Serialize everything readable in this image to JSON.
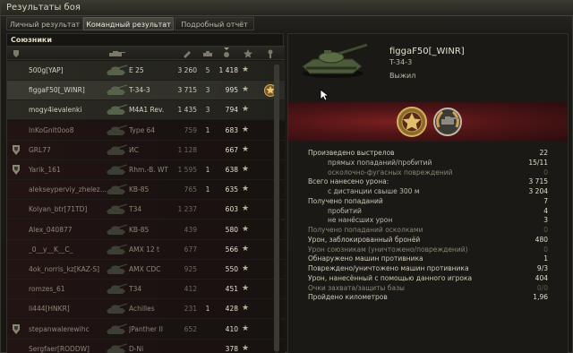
{
  "window": {
    "title": "Результаты боя"
  },
  "tabs": [
    "Личный результат",
    "Командный результат",
    "Подробный отчёт"
  ],
  "active_tab": 1,
  "left": {
    "section_title": "Союзники",
    "players": [
      {
        "player": "500g[YAP]",
        "tank": "E 25",
        "damage": "3 260",
        "kills": "5",
        "xp": "1 418",
        "state": "alive",
        "icon": "none"
      },
      {
        "player": "figgaF50[_WINR]",
        "tank": "T-34-3",
        "damage": "3 715",
        "kills": "3",
        "xp": "995",
        "state": "selected",
        "icon": "none",
        "badge": "medal-icon"
      },
      {
        "player": "mogy4ievalenki",
        "tank": "M4A1 Rev.",
        "damage": "1 435",
        "kills": "3",
        "xp": "794",
        "state": "alive",
        "icon": "none"
      },
      {
        "player": "InKoGnIt0oo8",
        "tank": "Type 64",
        "damage": "759",
        "kills": "1",
        "xp": "683",
        "state": "dead",
        "icon": "none"
      },
      {
        "player": "GRL77",
        "tank": "ИС",
        "damage": "1 128",
        "kills": "",
        "xp": "667",
        "state": "dead",
        "icon": "platoon"
      },
      {
        "player": "Yarik_161",
        "tank": "Rhm.-B. WT",
        "damage": "1 595",
        "kills": "1",
        "xp": "638",
        "state": "dead",
        "icon": "platoon"
      },
      {
        "player": "alekseyperviy_zhelez...",
        "tank": "KB-85",
        "damage": "765",
        "kills": "1",
        "xp": "635",
        "state": "dead",
        "icon": "none"
      },
      {
        "player": "Kolyan_btr[71TD]",
        "tank": "T34",
        "damage": "1 237",
        "kills": "",
        "xp": "603",
        "state": "dead",
        "icon": "none"
      },
      {
        "player": "Alex_040877",
        "tank": "KB-85",
        "damage": "439",
        "kills": "",
        "xp": "580",
        "state": "dead",
        "icon": "none"
      },
      {
        "player": "_0__y__K__C_",
        "tank": "AMX 12 t",
        "damage": "677",
        "kills": "",
        "xp": "566",
        "state": "dead",
        "icon": "none"
      },
      {
        "player": "4ok_norris_kz[KAZ-S]",
        "tank": "AMX CDC",
        "damage": "925",
        "kills": "",
        "xp": "550",
        "state": "dead",
        "icon": "none"
      },
      {
        "player": "romzes_61",
        "tank": "T34",
        "damage": "412",
        "kills": "",
        "xp": "451",
        "state": "dead",
        "icon": "none"
      },
      {
        "player": "li444[HNKR]",
        "tank": "Achilles",
        "damage": "231",
        "kills": "1",
        "xp": "428",
        "state": "dead",
        "icon": "none"
      },
      {
        "player": "stepanwalerewihc",
        "tank": "JPanther II",
        "damage": "652",
        "kills": "",
        "xp": "410",
        "state": "dead",
        "icon": "platoon"
      },
      {
        "player": "Sergfaer[RODDW]",
        "tank": "D-Ni",
        "damage": "",
        "kills": "",
        "xp": "378",
        "state": "dead",
        "icon": "none"
      }
    ]
  },
  "right": {
    "player_name": "figgaF50[_WINR]",
    "tank": "T-34-3",
    "status": "Выжил",
    "medals": [
      "medal-star-icon",
      "medal-wreath-icon"
    ],
    "stats": [
      {
        "label": "Произведено выстрелов",
        "value": "22",
        "type": "main"
      },
      {
        "label": "прямых попаданий/пробитий",
        "value": "15/11",
        "type": "sub"
      },
      {
        "label": "осколочно-фугасных повреждений",
        "value": "0",
        "type": "sub zero"
      },
      {
        "label": "Всего нанесено урона:",
        "value": "3 715",
        "type": "main"
      },
      {
        "label": "с дистанции свыше 300 м",
        "value": "3 204",
        "type": "sub"
      },
      {
        "label": "Получено попаданий",
        "value": "7",
        "type": "main"
      },
      {
        "label": "пробитий",
        "value": "4",
        "type": "sub"
      },
      {
        "label": "не нанёсших урон",
        "value": "3",
        "type": "sub"
      },
      {
        "label": "Получено попаданий осколками",
        "value": "0",
        "type": "main zero"
      },
      {
        "label": "Урон, заблокированный бронёй",
        "value": "480",
        "type": "main"
      },
      {
        "label": "Урон союзникам (уничтожено/повреждений)",
        "value": "0",
        "type": "main zero"
      },
      {
        "label": "Обнаружено машин противника",
        "value": "1",
        "type": "main"
      },
      {
        "label": "Повреждено/уничтожено машин противника",
        "value": "9/3",
        "type": "main"
      },
      {
        "label": "Урон, нанесённый с помощью данного игрока",
        "value": "404",
        "type": "main"
      },
      {
        "label": "Очки захвата/защиты базы",
        "value": "0/0",
        "type": "main zero"
      },
      {
        "label": "Пройдено километров",
        "value": "1,96",
        "type": "main"
      }
    ]
  }
}
